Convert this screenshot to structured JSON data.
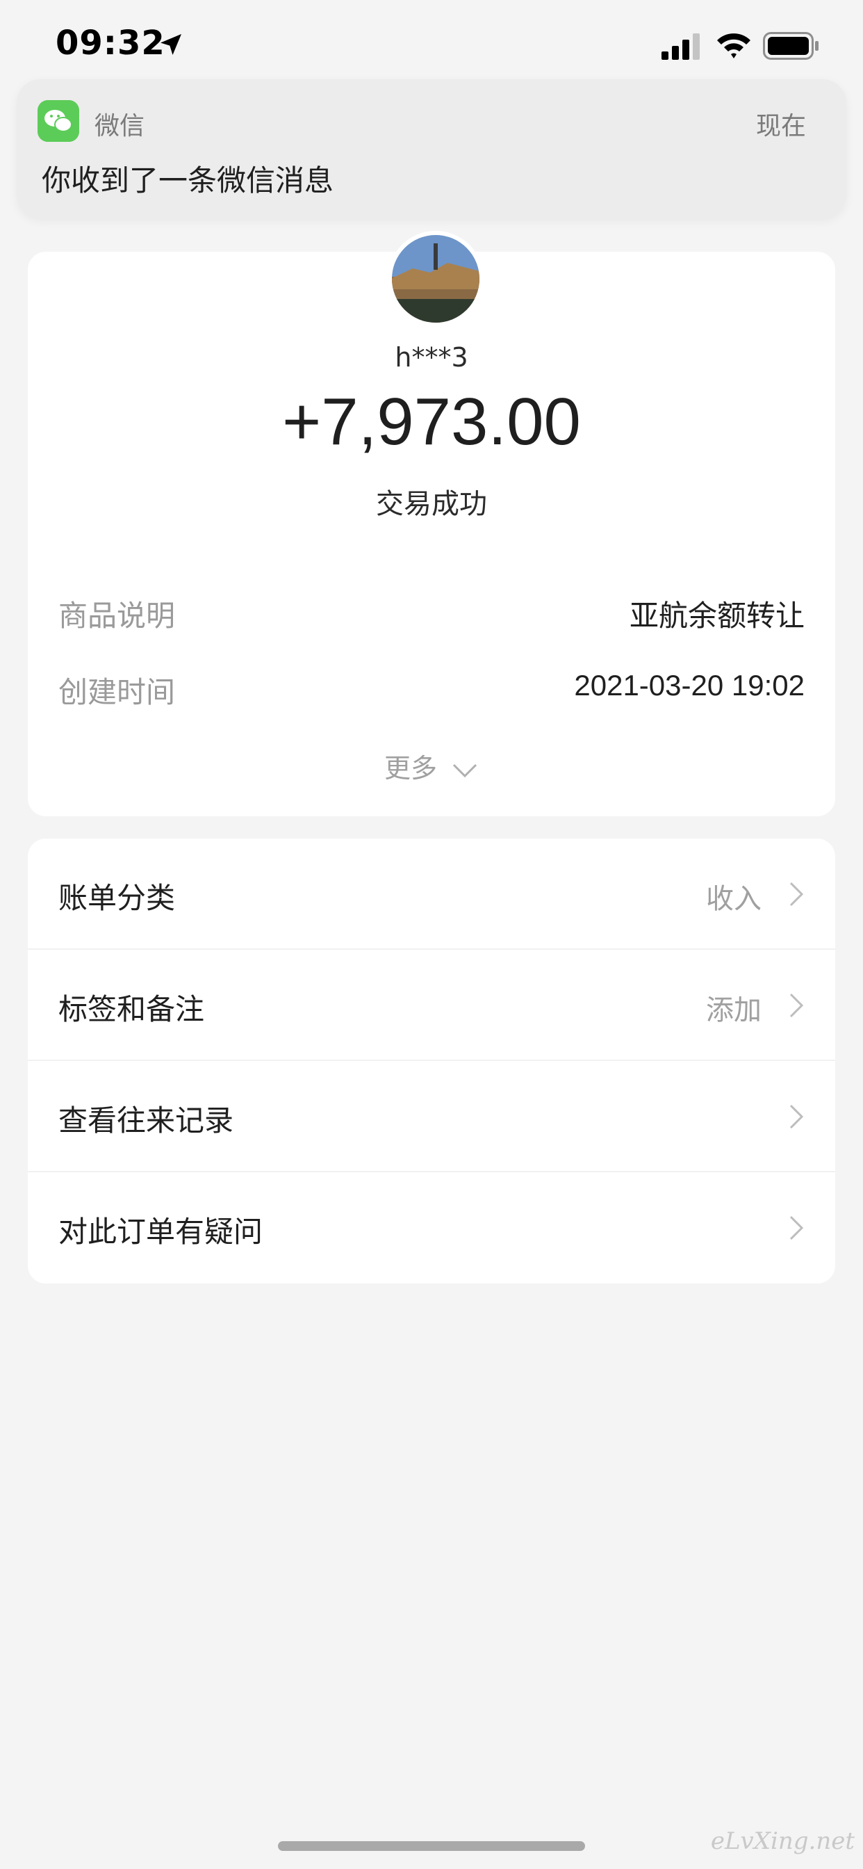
{
  "status_bar": {
    "time": "09:32"
  },
  "notification": {
    "app_name": "微信",
    "time": "现在",
    "message": "你收到了一条微信消息"
  },
  "transaction": {
    "payer": "h***3",
    "amount": "+7,973.00",
    "status": "交易成功",
    "details": [
      {
        "label": "商品说明",
        "value": "亚航余额转让"
      },
      {
        "label": "创建时间",
        "value": "2021-03-20 19:02"
      }
    ],
    "more_label": "更多"
  },
  "menu": [
    {
      "label": "账单分类",
      "value": "收入"
    },
    {
      "label": "标签和备注",
      "value": "添加"
    },
    {
      "label": "查看往来记录",
      "value": ""
    },
    {
      "label": "对此订单有疑问",
      "value": ""
    }
  ],
  "watermark": "eLvXing.net",
  "colors": {
    "wechat_green": "#5ccc58",
    "page_bg": "#f4f4f4",
    "muted_text": "#9a9a9a"
  },
  "icons": [
    "location-arrow-icon",
    "cellular-signal-icon",
    "wifi-icon",
    "battery-icon",
    "wechat-icon",
    "chevron-down-icon",
    "chevron-right-icon"
  ]
}
